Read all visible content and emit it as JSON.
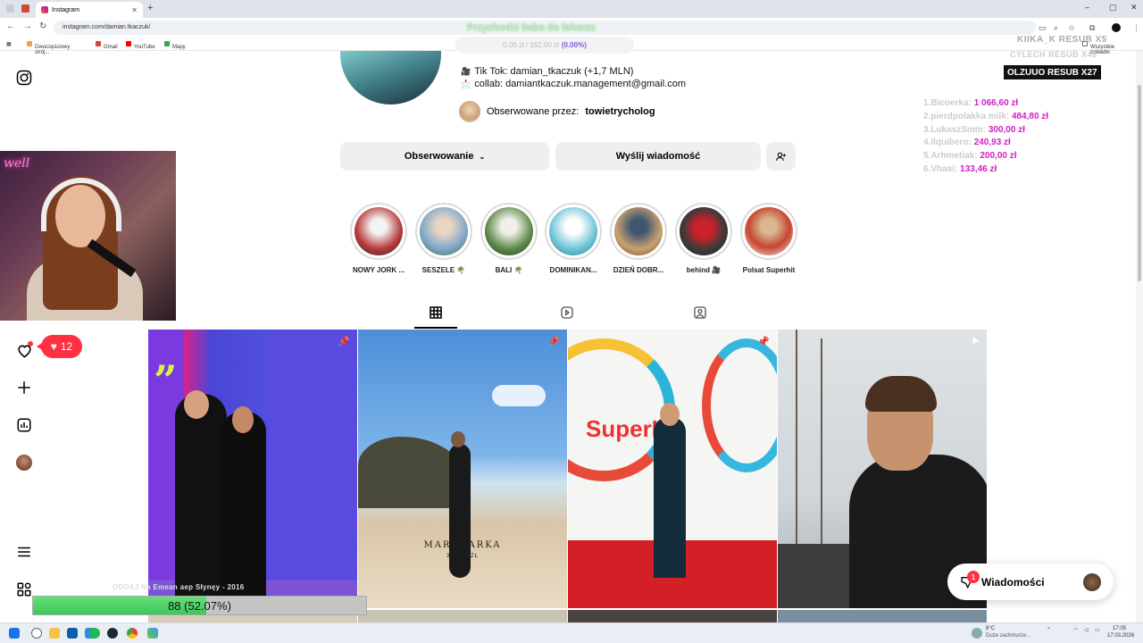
{
  "browser": {
    "tab_title": "Instagram",
    "url": "instagram.com/damian.tkaczuk/",
    "bookmarks": [
      "Dwuczęściowy strój...",
      "Gmail",
      "YouTube",
      "Mapy"
    ],
    "all_bookmarks": "Wszystkie zakładki"
  },
  "sidebar": {
    "logo": "instagram-icon",
    "items": [
      "heart-icon",
      "plus-icon",
      "stats-icon",
      "avatar",
      "menu-icon",
      "apps-icon"
    ],
    "notification_count": "12"
  },
  "profile": {
    "bio": [
      {
        "icon": "🎥",
        "text": "Tik Tok: damian_tkaczuk (+1,7 MLN)"
      },
      {
        "icon": "📩",
        "text": "collab: damiantkaczuk.management@gmail.com"
      }
    ],
    "followed_by_label": "Obserwowane przez:",
    "followed_by_user": "towietrycholog",
    "btn_following": "Obserwowanie",
    "btn_message": "Wyślij wiadomość"
  },
  "highlights": [
    {
      "label": "NOWY JORK ...",
      "color": "#b73a3a"
    },
    {
      "label": "SESZELE 🌴",
      "color": "#7fa8c8"
    },
    {
      "label": "BALI 🌴",
      "color": "#5e8a4a"
    },
    {
      "label": "DOMINIKAN...",
      "color": "#6fc5d8"
    },
    {
      "label": "DZIEŃ DOBR...",
      "color": "#c9a170"
    },
    {
      "label": "behind 🎥",
      "color": "#c9222a"
    },
    {
      "label": "Polsat Superhit",
      "color": "#d8b890"
    }
  ],
  "posts": [
    {
      "name": "post-bestsellery",
      "pinned": true,
      "text": ""
    },
    {
      "name": "post-marynarka",
      "pinned": true,
      "text": "MARYNARKA",
      "price": "399.99 ZŁ"
    },
    {
      "name": "post-superhit",
      "pinned": true,
      "text": "SuperHit"
    },
    {
      "name": "post-ship",
      "pinned": false,
      "text": ""
    }
  ],
  "messages_widget": {
    "label": "Wiadomości",
    "badge": "1"
  },
  "overlay": {
    "title": "Przychodzi baba do lekarza",
    "progress_text": "0.00 zł / 162.00 zł",
    "progress_pct": "(0.00%)",
    "right_lines": [
      "KIIKA_K  RESUB X5",
      "CYLECH  RESUB X49"
    ],
    "resub_banner": "OLZUUO  RESUB X27",
    "donors": [
      {
        "name": "1.Bicoerka:",
        "amount": "1 066,60 zł"
      },
      {
        "name": "2.pierdpolakka milk:",
        "amount": "484,80 zł"
      },
      {
        "name": "3.LukaszSmm:",
        "amount": "300,00 zł"
      },
      {
        "name": "4.Ilquibero:",
        "amount": "240,93 zł"
      },
      {
        "name": "5.Arhmetiak:",
        "amount": "200,00 zł"
      },
      {
        "name": "6.Vhasi:",
        "amount": "133,46 zł"
      }
    ],
    "goal_caption": "ODDAJ Na Emean aep Słynęy - 2016",
    "goal_label": "88 (52.07%)",
    "goal_fraction": 0.5207
  },
  "taskbar": {
    "weather": "8°C",
    "weather_desc": "Duże zachmurze...",
    "time": "17:05",
    "date": "17.03.2026"
  }
}
